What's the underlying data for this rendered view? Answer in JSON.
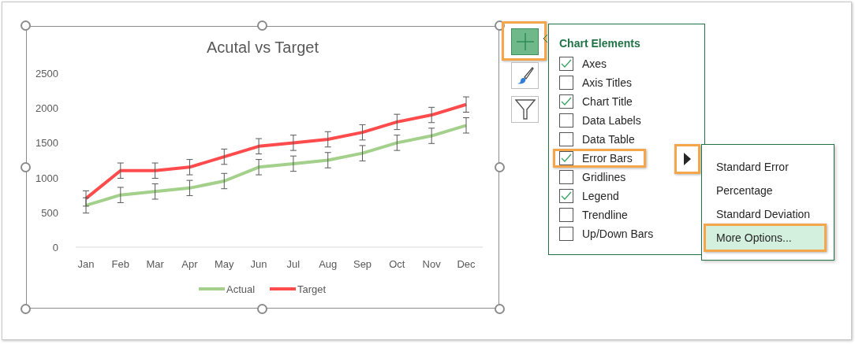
{
  "chart": {
    "chart_data": {
      "type": "line",
      "title": "Acutal vs Target",
      "categories": [
        "Jan",
        "Feb",
        "Mar",
        "Apr",
        "May",
        "Jun",
        "Jul",
        "Aug",
        "Sep",
        "Oct",
        "Nov",
        "Dec"
      ],
      "series": [
        {
          "name": "Actual",
          "color": "#a3d08a",
          "values": [
            600,
            750,
            800,
            850,
            950,
            1150,
            1200,
            1250,
            1350,
            1500,
            1600,
            1750
          ]
        },
        {
          "name": "Target",
          "color": "#ff4b4b",
          "values": [
            700,
            1100,
            1100,
            1150,
            1300,
            1450,
            1500,
            1550,
            1650,
            1800,
            1900,
            2050
          ]
        }
      ],
      "legend": "bottom",
      "ylim": [
        0,
        2500
      ],
      "yticks": [
        0,
        500,
        1000,
        1500,
        2000,
        2500
      ]
    }
  },
  "chart_tools": [
    {
      "kind": "elements",
      "selected": true
    },
    {
      "kind": "styles",
      "selected": false
    },
    {
      "kind": "filters",
      "selected": false
    }
  ],
  "chart_elements": {
    "title": "Chart Elements",
    "items": [
      {
        "label": "Axes",
        "checked": true,
        "selected": false
      },
      {
        "label": "Axis Titles",
        "checked": false,
        "selected": false
      },
      {
        "label": "Chart Title",
        "checked": true,
        "selected": false
      },
      {
        "label": "Data Labels",
        "checked": false,
        "selected": false
      },
      {
        "label": "Data Table",
        "checked": false,
        "selected": false
      },
      {
        "label": "Error Bars",
        "checked": true,
        "selected": true
      },
      {
        "label": "Gridlines",
        "checked": false,
        "selected": false
      },
      {
        "label": "Legend",
        "checked": true,
        "selected": false
      },
      {
        "label": "Trendline",
        "checked": false,
        "selected": false
      },
      {
        "label": "Up/Down Bars",
        "checked": false,
        "selected": false
      }
    ]
  },
  "error_bars_menu": {
    "expanded": true,
    "items": [
      {
        "label": "Standard Error",
        "selected": false
      },
      {
        "label": "Percentage",
        "selected": false
      },
      {
        "label": "Standard Deviation",
        "selected": false
      },
      {
        "label": "More Options...",
        "selected": true
      }
    ]
  }
}
